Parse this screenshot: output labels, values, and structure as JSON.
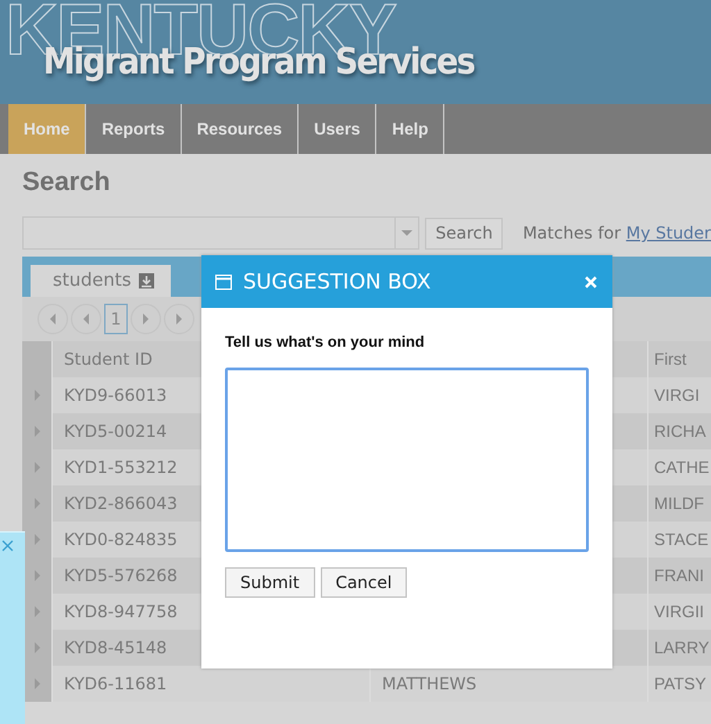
{
  "header": {
    "watermark": "KENTUCKY",
    "title": "Migrant Program Services"
  },
  "nav": [
    {
      "label": "Home",
      "selected": true
    },
    {
      "label": "Reports",
      "selected": false
    },
    {
      "label": "Resources",
      "selected": false
    },
    {
      "label": "Users",
      "selected": false
    },
    {
      "label": "Help",
      "selected": false
    }
  ],
  "search": {
    "heading": "Search",
    "button": "Search",
    "matches_label": "Matches for",
    "matches_link": "My Studer"
  },
  "tabs": [
    {
      "label": "students",
      "selected": true
    }
  ],
  "pager": {
    "page": "1"
  },
  "table": {
    "columns": [
      "Student ID",
      "",
      "First"
    ],
    "rows": [
      {
        "id": "KYD9-66013",
        "last": "",
        "first": "VIRGI"
      },
      {
        "id": "KYD5-00214",
        "last": "",
        "first": "RICHA"
      },
      {
        "id": "KYD1-553212",
        "last": "",
        "first": "CATHE"
      },
      {
        "id": "KYD2-866043",
        "last": "",
        "first": "MILDF"
      },
      {
        "id": "KYD0-824835",
        "last": "",
        "first": "STACE"
      },
      {
        "id": "KYD5-576268",
        "last": "",
        "first": "FRANI"
      },
      {
        "id": "KYD8-947758",
        "last": "",
        "first": "VIRGII"
      },
      {
        "id": "KYD8-45148",
        "last": "",
        "first": "LARRY"
      },
      {
        "id": "KYD6-11681",
        "last": "MATTHEWS",
        "first": "PATSY"
      }
    ]
  },
  "dialog": {
    "title": "SUGGESTION BOX",
    "prompt": "Tell us what's on your mind",
    "buttons": [
      "Submit",
      "Cancel"
    ]
  }
}
